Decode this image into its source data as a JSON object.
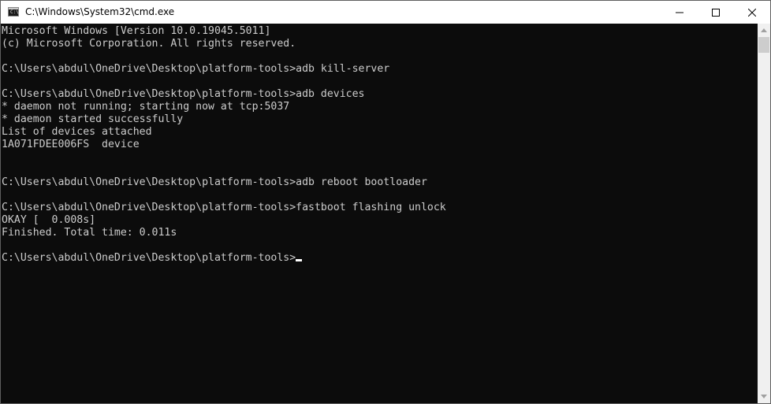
{
  "window": {
    "title": "C:\\Windows\\System32\\cmd.exe",
    "icon": "cmd-icon",
    "icon_text": "C:\\"
  },
  "caption_buttons": {
    "minimize": "minimize-icon",
    "maximize": "maximize-icon",
    "close": "close-icon"
  },
  "terminal": {
    "lines": [
      "Microsoft Windows [Version 10.0.19045.5011]",
      "(c) Microsoft Corporation. All rights reserved.",
      "",
      "C:\\Users\\abdul\\OneDrive\\Desktop\\platform-tools>adb kill-server",
      "",
      "C:\\Users\\abdul\\OneDrive\\Desktop\\platform-tools>adb devices",
      "* daemon not running; starting now at tcp:5037",
      "* daemon started successfully",
      "List of devices attached",
      "1A071FDEE006FS  device",
      "",
      "",
      "C:\\Users\\abdul\\OneDrive\\Desktop\\platform-tools>adb reboot bootloader",
      "",
      "C:\\Users\\abdul\\OneDrive\\Desktop\\platform-tools>fastboot flashing unlock",
      "OKAY [  0.008s]",
      "Finished. Total time: 0.011s",
      "",
      "C:\\Users\\abdul\\OneDrive\\Desktop\\platform-tools>"
    ]
  },
  "colors": {
    "background": "#0c0c0c",
    "text": "#cccccc",
    "titlebar": "#ffffff"
  }
}
